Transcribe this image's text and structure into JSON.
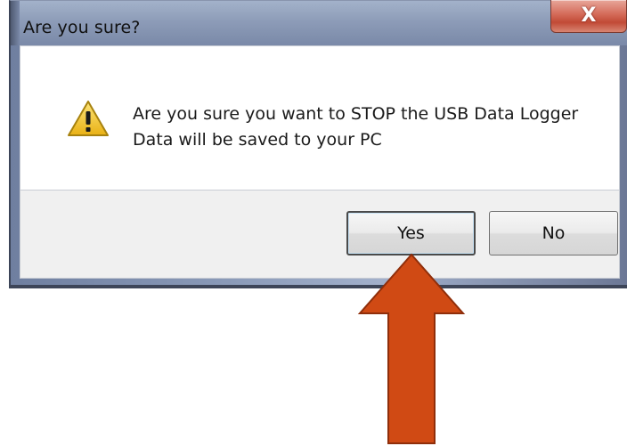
{
  "dialog": {
    "title": "Are you sure?",
    "close_label": "X",
    "message_line1": "Are you sure you want to STOP the USB Data Logger",
    "message_line2": "Data will be saved to your PC",
    "icon": "warning-icon"
  },
  "buttons": {
    "yes_label": "Yes",
    "no_label": "No"
  },
  "annotation": {
    "arrow_color": "#d04a14",
    "arrow_target": "yes-button"
  },
  "colors": {
    "close_button": "#c94f3a",
    "warning_icon": "#f3c21b"
  }
}
